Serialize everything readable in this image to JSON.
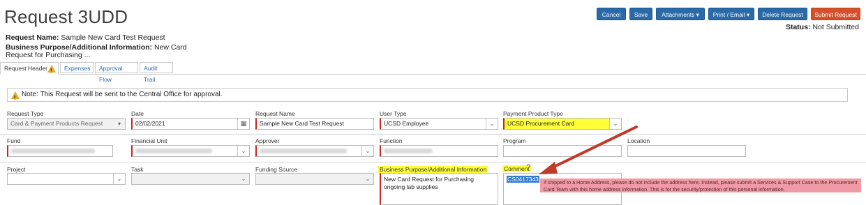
{
  "header": {
    "title": "Request 3UDD",
    "request_name_label": "Request Name:",
    "request_name_value": "Sample New Card Test Request",
    "purpose_label": "Business Purpose/Additional Information:",
    "purpose_value_line1": "New Card",
    "purpose_value_line2": "Request for Purchasing ...",
    "status_label": "Status:",
    "status_value": "Not Submitted"
  },
  "toolbar": {
    "cancel": "Cancel",
    "save": "Save",
    "attachments": "Attachments ▾",
    "print_email": "Print / Email ▾",
    "delete": "Delete Request",
    "submit": "Submit Request"
  },
  "tabs": [
    "Request Header",
    "Expenses",
    "Approval Flow",
    "Audit Trail"
  ],
  "note": "Note: This Request will be sent to the Central Office for approval.",
  "form": {
    "request_type_label": "Request Type",
    "request_type_value": "Card & Payment Products Request",
    "date_label": "Date",
    "date_value": "02/02/2021",
    "request_name_label": "Request Name",
    "request_name_value": "Sample New Card Test Request",
    "user_type_label": "User Type",
    "user_type_value": "UCSD Employee",
    "payment_product_type_label": "Payment Product Type",
    "payment_product_type_value": "UCSD Procurement Card",
    "fund_label": "Fund",
    "financial_unit_label": "Financial Unit",
    "approver_label": "Approver",
    "function_label": "Function",
    "program_label": "Program",
    "location_label": "Location",
    "project_label": "Project",
    "task_label": "Task",
    "funding_source_label": "Funding Source",
    "business_purpose_label": "Business Purpose/Additional Information",
    "business_purpose_value": "New Card Request for Purchasing ongoing lab supplies",
    "comment_label": "Comment",
    "comment_value": "CS0417343"
  },
  "tooltip": "If shipped to a Home Address, please do not include the address here. Instead, please submit a Services & Support Case to the Procurement Card Team with this home address information. This is for the security/protection of this personal information.",
  "colors": {
    "primary_button": "#2a6aa8",
    "submit_button": "#d6512b",
    "highlight": "#ffff3a",
    "arrow": "#c0392b",
    "tooltip_bg": "#ef9aa5"
  }
}
